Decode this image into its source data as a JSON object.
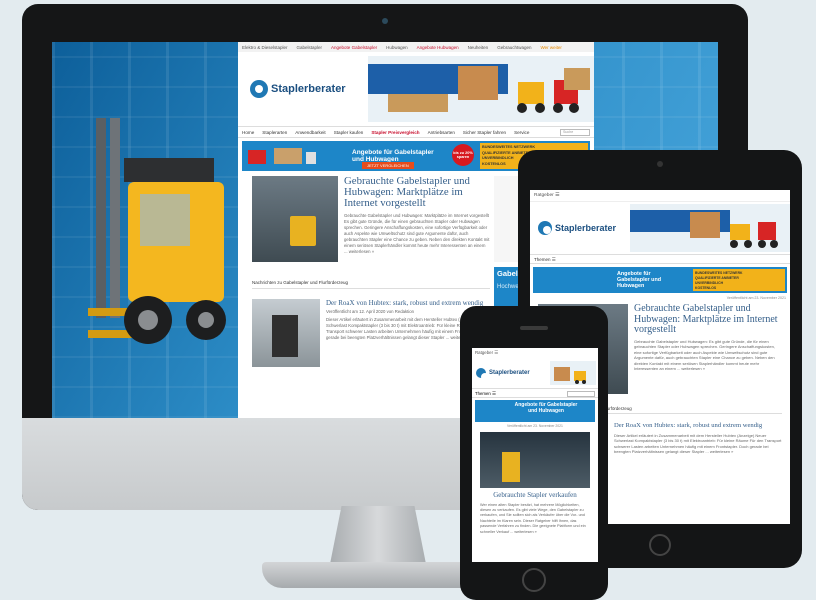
{
  "site": {
    "logo_text": "Staplerberater",
    "topnav": [
      "Elektro & Dieselstapler",
      "Gabelstapler",
      "Angebote Gabelstapler",
      "Hubwagen",
      "Angebote Hubwagen",
      "Neuheiten",
      "Gebrauchtwagen",
      "Wer weiter"
    ],
    "mainnav": [
      "Home",
      "Staplerarten",
      "Anwendbarkeit",
      "Stapler kaufen",
      "Stapler Preisvergleich",
      "Antriebsarten",
      "Sicher Stapler fahren",
      "Service"
    ],
    "search_placeholder": "Suche",
    "ad": {
      "title": "Angebote für Gabelstapler und Hubwagen",
      "badge": "bis zu 20% sparen",
      "cta": "JETZT VERGLEICHEN",
      "checks": [
        "BUNDESWEITES NETZWERK",
        "QUALIFIZIERTE ANBIETER",
        "UNVERBINDLICH",
        "KOSTENLOS"
      ]
    },
    "article1": {
      "title": "Gebrauchte Gabelstapler und Hubwagen: Marktplätze im Internet vorgestellt",
      "excerpt": "Gebrauchte Gabelstapler und Hubwagen: Marktplätze im Internet vorgestellt Es gibt gute Gründe, die für einen gebrauchten Stapler oder Hubwagen sprechen. Geringere Anschaffungskosten, eine sofortige Verfügbarkeit oder auch Aspekte wie Umweltschutz sind gute Argumente dafür, auch gebrauchten Stapler eine Chance zu geben. Neben den direkten Kontakt mit einem seriösen Staplerhändler kommt heute mehr Interessenten an einem ... weiterlesen »"
    },
    "section_heading": "Nachrichten zu Gabelstapler und Flurförderzeug",
    "article2": {
      "title": "Der RoaX von Hubtex: stark, robust und extrem wendig",
      "meta": "Veröffentlicht am 12. April 2020 von Redaktion",
      "excerpt": "Dieser Artikel erläutert in Zusammenarbeit mit dem Hersteller Hubtex (Anzeige) Neuer Schwerlast Kompaktstapler (3 bis 30 t) mit Elektroantrieb: Für kleine Räume Für den Transport schwerer Lasten arbeiten Unternehmen häufig mit einem Frontstapler. Doch gerade bei beengten Platzverhältnissen gelangt dieser Stapler ... weiterlesen »"
    },
    "sidebar_ad": {
      "title": "Gabelstapler-Vergleich",
      "subtitle": "Hochwertige Gabelstapler"
    }
  },
  "tablet": {
    "bar": "Ratgeber ☰",
    "menu": "Themen ☰",
    "date": "Veröffentlicht am 23. November 2021",
    "article_title": "Gebrauchte Gabelstapler und Hubwagen: Marktplätze im Internet vorgestellt",
    "article_excerpt": "Gebrauchte Gabelstapler und Hubwagen: Es gibt gute Gründe, die für einen gebrauchten Stapler oder Hubwagen sprechen. Geringere Anschaffungskosten, eine sofortige Verfügbarkeit oder auch Aspekte wie Umweltschutz sind gute Argumente dafür, auch gebrauchten Stapler eine Chance zu geben. Neben den direkten Kontakt mit einem seriösen Staplerhändler kommt heute mehr Interessenten an einem ... weiterlesen »",
    "section": "Nachrichten zu Gabelstapler und Flurförderzeug",
    "article2_title": "Der RoaX von Hubtex: stark, robust und extrem wendig",
    "article2_excerpt": "Dieser Artikel erläutert in Zusammenarbeit mit dem Hersteller Hubtex (Anzeige) Neuer Schwerlast Kompaktstapler (3 bis 30 t) mit Elektroantrieb: Für kleine Räume Für den Transport schwerer Lasten arbeiten Unternehmen häufig mit einem Frontstapler. Doch gerade bei beengten Platzverhältnissen gelangt dieser Stapler ... weiterlesen »"
  },
  "phone": {
    "bar": "Ratgeber ☰",
    "menu": "Themen ☰",
    "ad_title": "Angebote für Gabelstapler und Hubwagen",
    "date": "Veröffentlicht am 23. November 2021",
    "article_title": "Gebrauchte Stapler verkaufen",
    "article_excerpt": "Wer einen alten Stapler besitzt, hat mehrere Möglichkeiten, diesen zu verkaufen. Es gibt viele Wege, den Gabelstapler zu verkaufen, und Sie sollten sich als Verkäufer über die Vor- und Nachteile im Klaren sein. Dieser Ratgeber hilft Ihnen, das passende Verfahren zu finden. Die geeignete Plattform und ein schneller Verkauf ... weiterlesen »"
  },
  "colors": {
    "brand_blue": "#1d86c8",
    "headline_blue": "#355f8a",
    "accent_red": "#c8102e",
    "accent_yellow": "#f2b21a"
  }
}
